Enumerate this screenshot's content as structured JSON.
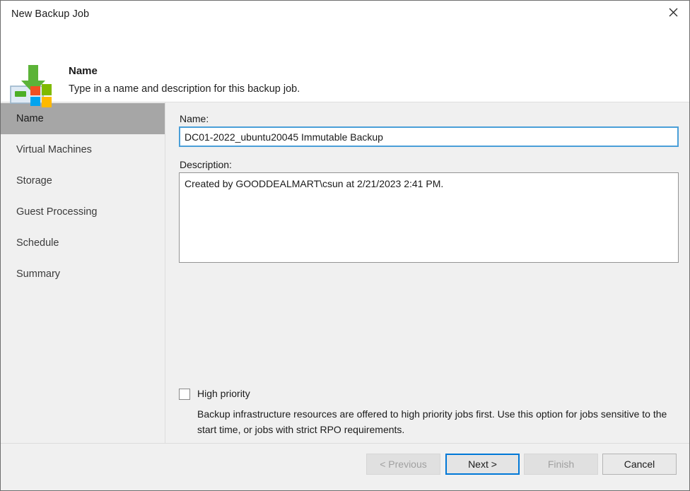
{
  "window": {
    "title": "New Backup Job",
    "close_icon": "close-icon"
  },
  "header": {
    "icon": "backup-job-icon",
    "title": "Name",
    "subtitle": "Type in a name and description for this backup job."
  },
  "sidebar": {
    "items": [
      {
        "label": "Name",
        "selected": true
      },
      {
        "label": "Virtual Machines",
        "selected": false
      },
      {
        "label": "Storage",
        "selected": false
      },
      {
        "label": "Guest Processing",
        "selected": false
      },
      {
        "label": "Schedule",
        "selected": false
      },
      {
        "label": "Summary",
        "selected": false
      }
    ]
  },
  "form": {
    "name_label": "Name:",
    "name_value": "DC01-2022_ubuntu20045 Immutable Backup",
    "name_placeholder": "",
    "description_label": "Description:",
    "description_value": "Created by GOODDEALMART\\csun at 2/21/2023 2:41 PM.",
    "description_placeholder": "",
    "high_priority_label": "High priority",
    "high_priority_checked": false,
    "high_priority_description": "Backup infrastructure resources are offered to high priority jobs first. Use this option for jobs sensitive to the start time, or jobs with strict RPO requirements."
  },
  "footer": {
    "previous_label": "< Previous",
    "next_label": "Next >",
    "finish_label": "Finish",
    "cancel_label": "Cancel"
  },
  "colors": {
    "accent": "#0078d7",
    "field_focus_border": "#4a9fd8",
    "sidebar_selected": "#a6a6a6",
    "window_background": "#f0f0f0",
    "icon_green": "#5cb338",
    "icon_red": "#f25022",
    "icon_lime": "#7fba00",
    "icon_blue": "#00a4ef",
    "icon_yellow": "#ffb900"
  }
}
